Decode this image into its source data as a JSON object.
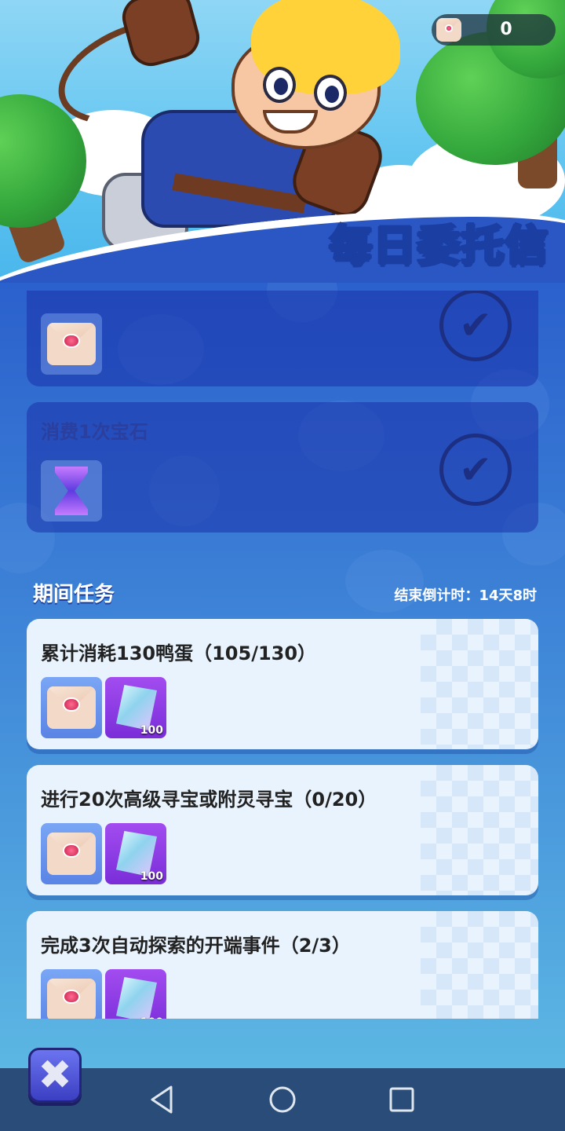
{
  "header": {
    "title": "每日委托信",
    "currency": {
      "icon": "envelope-icon",
      "value": "0"
    }
  },
  "daily_tasks": [
    {
      "title": "",
      "status": "completed",
      "rewards": [
        {
          "icon": "envelope-icon"
        }
      ]
    },
    {
      "title": "消费1次宝石",
      "status": "completed",
      "rewards": [
        {
          "icon": "hourglass-icon"
        }
      ]
    }
  ],
  "period_section": {
    "title": "期间任务",
    "countdown": "结束倒计时：14天8时"
  },
  "period_tasks": [
    {
      "title": "累计消耗130鸭蛋（105/130）",
      "rewards": [
        {
          "icon": "envelope-icon"
        },
        {
          "icon": "crystal-icon",
          "count": "100"
        }
      ]
    },
    {
      "title": "进行20次高级寻宝或附灵寻宝（0/20）",
      "rewards": [
        {
          "icon": "envelope-icon"
        },
        {
          "icon": "crystal-icon",
          "count": "100"
        }
      ]
    },
    {
      "title": "完成3次自动探索的开端事件（2/3）",
      "rewards": [
        {
          "icon": "envelope-icon"
        },
        {
          "icon": "crystal-icon",
          "count": "100"
        }
      ]
    }
  ],
  "close_button": {
    "icon": "close-icon"
  },
  "navbar": {
    "icons": [
      "back-icon",
      "home-icon",
      "recent-apps-icon",
      "chevron-down-icon"
    ]
  },
  "colors": {
    "primary_blue": "#2a5fcc",
    "card_light": "#e8f3fd",
    "reward_purple": "#7a2ed8"
  }
}
